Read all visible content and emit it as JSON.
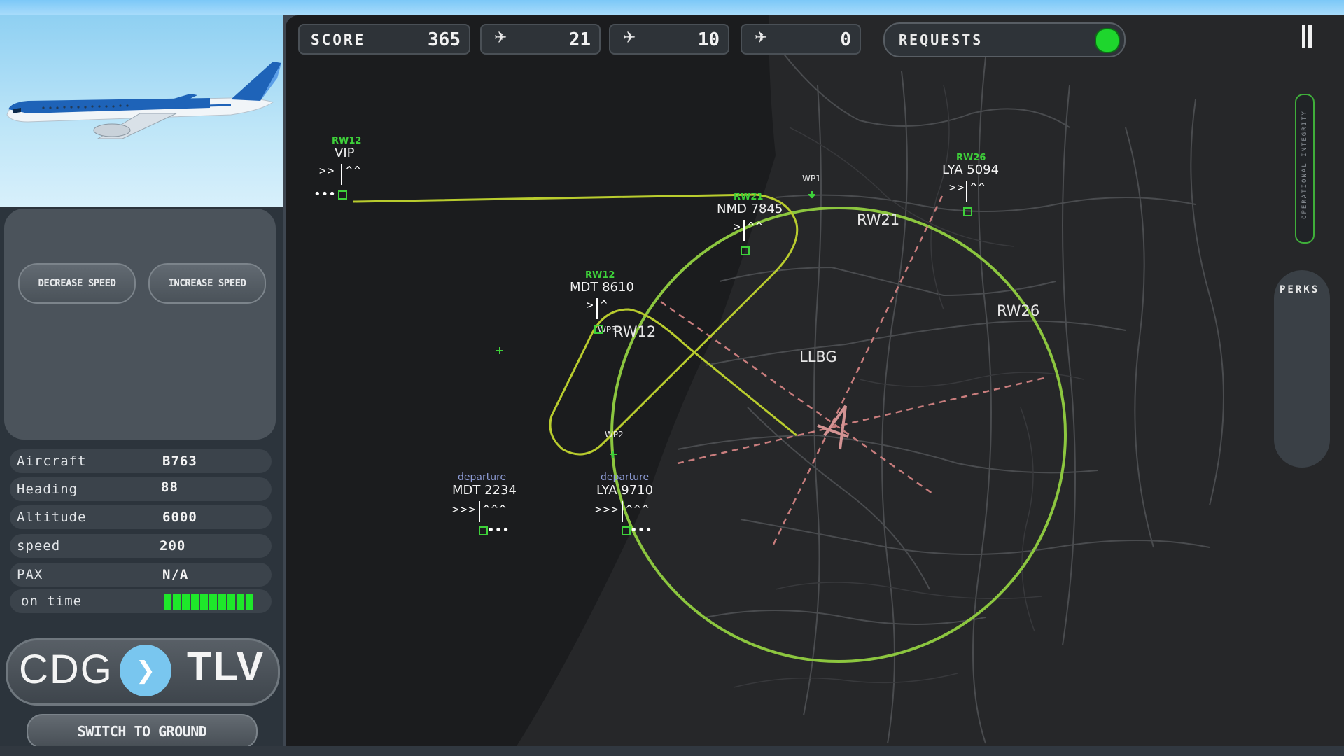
{
  "colors": {
    "radar_ring": "#8cc63f",
    "runway_dash": "#c87d7d",
    "route_line": "#b9cc2e",
    "ontime": "#1ee82a",
    "requests_ok": "#1ed62d"
  },
  "controls": {
    "decrease_speed": "DECREASE SPEED",
    "increase_speed": "INCREASE SPEED",
    "switch_to_ground": "SWITCH TO GROUND"
  },
  "aircraft_info": [
    {
      "label": "Aircraft",
      "value": "B763"
    },
    {
      "label": "Heading",
      "value": "88"
    },
    {
      "label": "Altitude",
      "value": "6000"
    },
    {
      "label": "speed",
      "value": "200"
    },
    {
      "label": "PAX",
      "value": "N/A"
    },
    {
      "label": "on time",
      "value": ""
    }
  ],
  "ontime_level": 1.0,
  "route": {
    "from": "CDG",
    "to": "TLV"
  },
  "stats": {
    "score_label": "SCORE",
    "score": "365",
    "landings": "21",
    "takeoffs": "10",
    "crashes": "0",
    "landings_icon": "plane-landing-icon",
    "takeoffs_icon": "plane-takeoff-icon",
    "crashes_icon": "plane-crash-icon"
  },
  "requests_label": "REQUESTS",
  "integrity_label": "OPERATIONAL INTEGRITY",
  "perks_label": "PERKS",
  "map": {
    "airport": "LLBG",
    "runways": [
      "RW21",
      "RW12",
      "RW26"
    ],
    "waypoints": [
      "WP1",
      "WP2",
      "WP3"
    ]
  },
  "flights": [
    {
      "callsign": "VIP",
      "tag": "RW12",
      "speed": ">>",
      "alt": "^^"
    },
    {
      "callsign": "MDT 8610",
      "tag": "RW12",
      "speed": ">",
      "alt": "^"
    },
    {
      "callsign": "NMD 7845",
      "tag": "RW21",
      "speed": ">",
      "alt": "^^"
    },
    {
      "callsign": "LYA 5094",
      "tag": "RW26",
      "speed": ">>",
      "alt": "^^"
    },
    {
      "callsign": "MDT 2234",
      "tag": "departure",
      "speed": ">>>",
      "alt": "^^^"
    },
    {
      "callsign": "LYA 9710",
      "tag": "departure",
      "speed": ">>>",
      "alt": "^^^"
    }
  ]
}
